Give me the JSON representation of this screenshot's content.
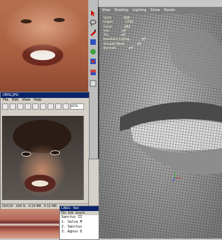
{
  "viewport": {
    "menu": [
      "View",
      "Shading",
      "Lighting",
      "Show",
      "Panels"
    ],
    "hud": [
      {
        "label": "Verts",
        "value": "828"
      },
      {
        "label": "Edges",
        "value": "1700"
      },
      {
        "label": "Faces",
        "value": "880"
      },
      {
        "label": "UVs",
        "value": "off"
      },
      {
        "label": "Tris",
        "value": "off"
      },
      {
        "label": "Backface Culling",
        "value": "off"
      },
      {
        "label": "Smooth Mesh",
        "value": "off"
      },
      {
        "label": "Normals",
        "value": "off"
      }
    ]
  },
  "image_window": {
    "title": "ORIG.JPG",
    "menu": [
      "File",
      "Edit",
      "View",
      "Help"
    ],
    "zoom": "42%",
    "status": [
      "50/116",
      "100 %",
      "0.16 MB",
      "0.12 MB"
    ]
  },
  "lines_window": {
    "title": "LINES - Not",
    "menu": [
      "File",
      "Edit",
      "Search"
    ],
    "heading": "Sanctus II",
    "lines": [
      "1. Salva M",
      "2. Sanctus",
      "3. Agnus D"
    ]
  },
  "colors": {
    "viewport_bg": "#6f6f6f",
    "titlebar": "#0a246a"
  }
}
